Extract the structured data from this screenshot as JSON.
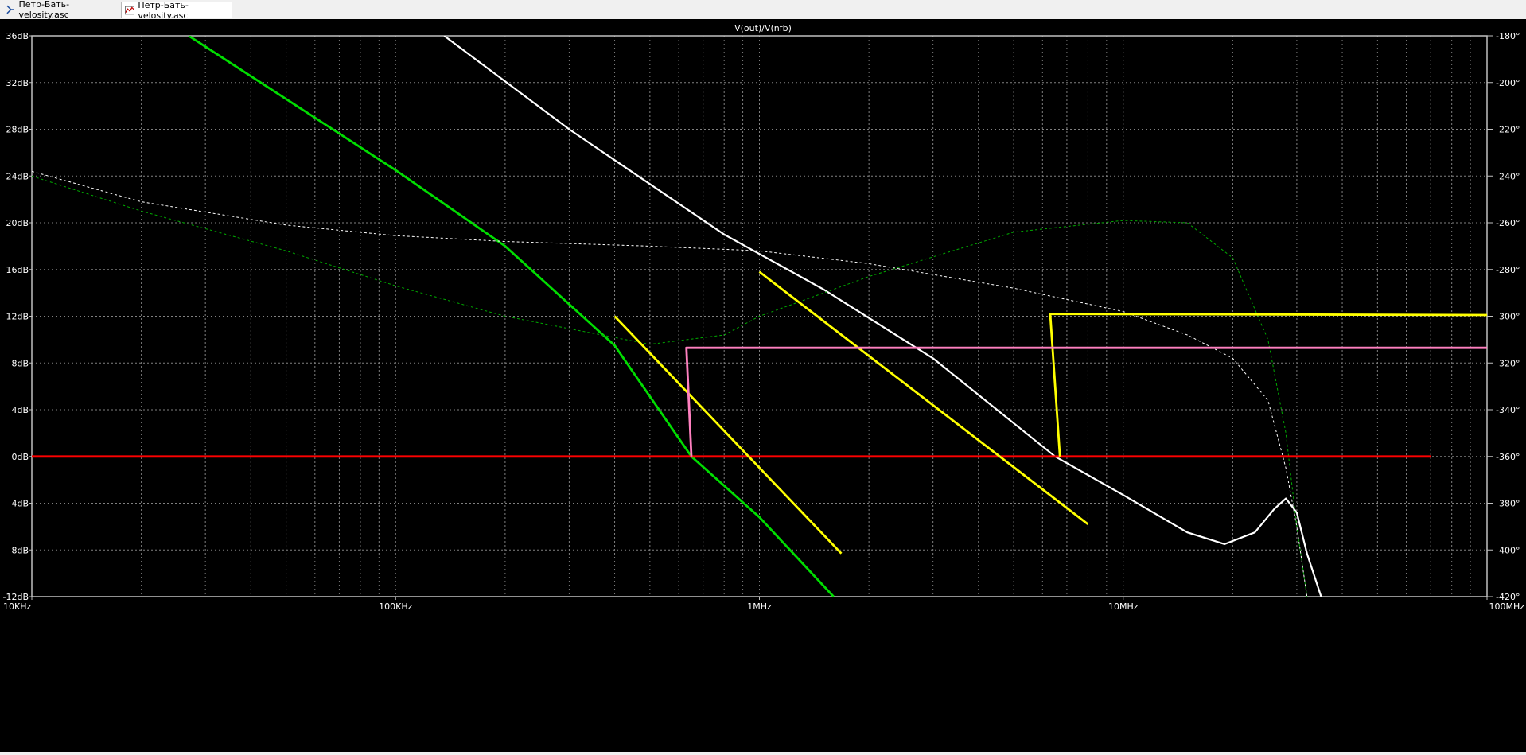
{
  "tabs": [
    {
      "label": "Петр-Бать-velosity.asc",
      "icon": "schematic-icon"
    },
    {
      "label": "Петр-Бать-velosity.asc",
      "icon": "waveform-icon"
    }
  ],
  "chart_data": {
    "type": "line",
    "title": "V(out)/V(nfb)",
    "x_scale": "log",
    "xlim_hz": [
      10000,
      100000000
    ],
    "x_ticks": [
      {
        "v": 10000,
        "label": "10KHz"
      },
      {
        "v": 100000,
        "label": "100KHz"
      },
      {
        "v": 1000000,
        "label": "1MHz"
      },
      {
        "v": 10000000,
        "label": "10MHz"
      },
      {
        "v": 100000000,
        "label": "100MHz"
      }
    ],
    "ylim_left_db": [
      -12,
      36
    ],
    "y_left_ticks": [
      "-12dB",
      "-8dB",
      "-4dB",
      "0dB",
      "4dB",
      "8dB",
      "12dB",
      "16dB",
      "20dB",
      "24dB",
      "28dB",
      "32dB",
      "36dB"
    ],
    "ylim_right_deg": [
      -420,
      -180
    ],
    "y_right_ticks": [
      "-420°",
      "-400°",
      "-380°",
      "-360°",
      "-340°",
      "-320°",
      "-300°",
      "-280°",
      "-260°",
      "-240°",
      "-220°",
      "-200°",
      "-180°"
    ],
    "grid": true,
    "colors": {
      "background": "#000000",
      "grid": "#808080",
      "axis": "#c0c0c0",
      "text": "#ffffff"
    },
    "series": [
      {
        "kind": "magnitude",
        "color": "#ffffff",
        "width": 2.2,
        "dashed": false,
        "points": [
          [
            136000,
            36
          ],
          [
            300000,
            28
          ],
          [
            800000,
            19
          ],
          [
            1500000,
            14.3
          ],
          [
            3000000,
            8.4
          ],
          [
            6500000,
            0
          ],
          [
            10000000,
            -3.3
          ],
          [
            15000000,
            -6.5
          ],
          [
            19000000,
            -7.5
          ],
          [
            23000000,
            -6.5
          ],
          [
            26000000,
            -4.5
          ],
          [
            28000000,
            -3.6
          ],
          [
            30000000,
            -4.8
          ],
          [
            32000000,
            -8.3
          ],
          [
            35000000,
            -12
          ]
        ]
      },
      {
        "kind": "magnitude",
        "color": "#00dd00",
        "width": 2.8,
        "dashed": false,
        "points": [
          [
            27000,
            36
          ],
          [
            100000,
            24.5
          ],
          [
            200000,
            18
          ],
          [
            400000,
            9.5
          ],
          [
            650000,
            0
          ],
          [
            1000000,
            -5.2
          ],
          [
            1600000,
            -12
          ]
        ]
      },
      {
        "kind": "phase",
        "color": "#ffffff",
        "width": 1,
        "dashed": true,
        "points": [
          [
            10000,
            -238
          ],
          [
            20000,
            -251
          ],
          [
            50000,
            -261
          ],
          [
            100000,
            -265.5
          ],
          [
            200000,
            -268
          ],
          [
            500000,
            -270
          ],
          [
            1000000,
            -272
          ],
          [
            2000000,
            -277.5
          ],
          [
            5000000,
            -288
          ],
          [
            10000000,
            -298
          ],
          [
            15000000,
            -308
          ],
          [
            20000,
            -251
          ],
          [
            20000000,
            -318
          ],
          [
            25000000,
            -336
          ],
          [
            28000000,
            -365
          ],
          [
            30000000,
            -390
          ],
          [
            32000000,
            -420
          ]
        ]
      },
      {
        "kind": "phase",
        "color": "#00aa00",
        "width": 1,
        "dashed": true,
        "points": [
          [
            10000,
            -240
          ],
          [
            20000,
            -255
          ],
          [
            50000,
            -272
          ],
          [
            100000,
            -287
          ],
          [
            200000,
            -300
          ],
          [
            500000,
            -312
          ],
          [
            800000,
            -308
          ],
          [
            1000000,
            -300
          ],
          [
            2000000,
            -283
          ],
          [
            5000000,
            -264
          ],
          [
            10000000,
            -259
          ],
          [
            15000000,
            -260
          ],
          [
            20000000,
            -275
          ],
          [
            25000000,
            -310
          ],
          [
            28000000,
            -350
          ],
          [
            30000000,
            -390
          ],
          [
            32000000,
            -420
          ]
        ]
      },
      {
        "kind": "magnitude",
        "color": "#ff0000",
        "width": 2.8,
        "dashed": false,
        "points": [
          [
            10000,
            0
          ],
          [
            70000000,
            0
          ]
        ]
      },
      {
        "kind": "magnitude",
        "color": "#ffff00",
        "width": 2.8,
        "dashed": false,
        "points": [
          [
            400000,
            12
          ],
          [
            1680000,
            -8.3
          ]
        ]
      },
      {
        "kind": "magnitude",
        "color": "#ffff00",
        "width": 2.8,
        "dashed": false,
        "points": [
          [
            1000000,
            15.8
          ],
          [
            8000000,
            -5.8
          ]
        ]
      },
      {
        "kind": "magnitude",
        "color": "#ffff00",
        "width": 2.8,
        "dashed": false,
        "points": [
          [
            6700000,
            0
          ],
          [
            6300000,
            12.2
          ],
          [
            100000000,
            12.1
          ]
        ]
      },
      {
        "kind": "magnitude",
        "color": "#ff80c0",
        "width": 2.8,
        "dashed": false,
        "points": [
          [
            650000,
            0
          ],
          [
            630000,
            9.3
          ],
          [
            100000000,
            9.3
          ]
        ]
      }
    ]
  }
}
